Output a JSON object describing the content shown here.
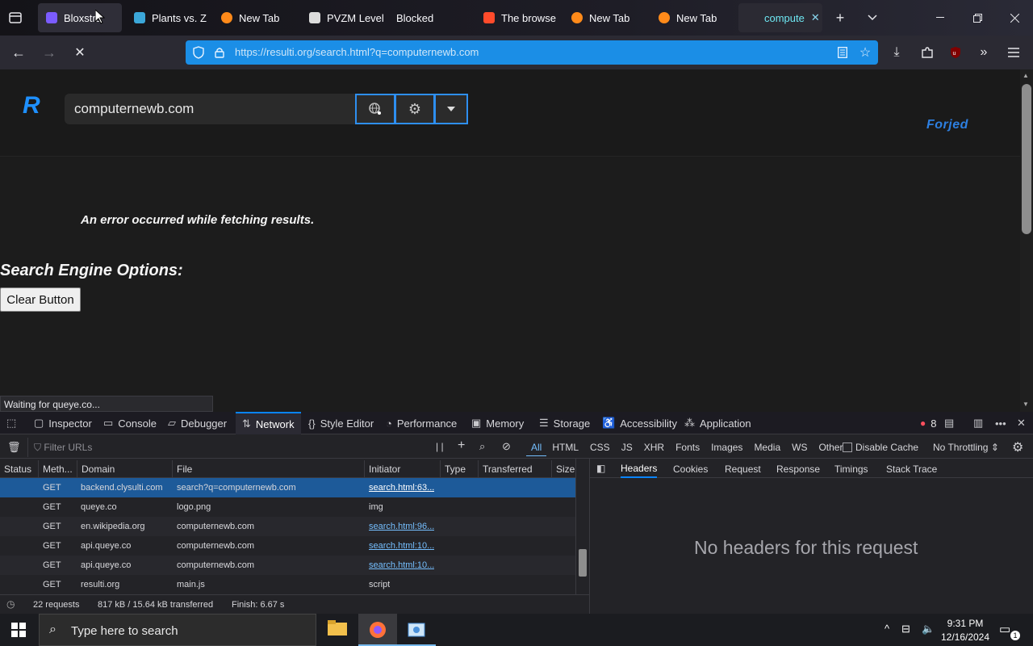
{
  "tabs": [
    {
      "label": "Bloxstra",
      "color": "#7b5cff"
    },
    {
      "label": "Plants vs. Z",
      "color": "#3ba7d9"
    },
    {
      "label": "New Tab",
      "color": "#ff8a1a"
    },
    {
      "label": "PVZM Level",
      "color": "#dcdcdc"
    },
    {
      "label": "Blocked",
      "color": ""
    },
    {
      "label": "The browse",
      "color": "#ff4b2b"
    },
    {
      "label": "New Tab",
      "color": "#ff8a1a"
    },
    {
      "label": "New Tab",
      "color": "#ff8a1a"
    },
    {
      "label": "compute",
      "color": ""
    }
  ],
  "url": {
    "domain": "resulti.org",
    "full": "https://resulti.org/search.html?q=computernewb.com"
  },
  "page": {
    "logo": "R",
    "search_value": "computernewb.com",
    "brand": "Forjed",
    "error": "An error occurred while fetching results.",
    "options_heading": "Search Engine Options:",
    "clear_button": "Clear Button",
    "status": "Waiting for queye.co..."
  },
  "devtools": {
    "tabs": [
      "Inspector",
      "Console",
      "Debugger",
      "Network",
      "Style Editor",
      "Performance",
      "Memory",
      "Storage",
      "Accessibility",
      "Application"
    ],
    "error_count": "8",
    "filter_placeholder": "Filter URLs",
    "type_filters": [
      "All",
      "HTML",
      "CSS",
      "JS",
      "XHR",
      "Fonts",
      "Images",
      "Media",
      "WS",
      "Other"
    ],
    "disable_cache": "Disable Cache",
    "throttling": "No Throttling",
    "columns": [
      "Status",
      "Meth...",
      "Domain",
      "File",
      "Initiator",
      "Type",
      "Transferred",
      "Size"
    ],
    "requests": [
      {
        "method": "GET",
        "domain": "backend.clysulti.com",
        "file": "search?q=computernewb.com",
        "initiator": "search.html:63...",
        "link": true
      },
      {
        "method": "GET",
        "domain": "queye.co",
        "file": "logo.png",
        "initiator": "img",
        "link": false
      },
      {
        "method": "GET",
        "domain": "en.wikipedia.org",
        "file": "computernewb.com",
        "initiator": "search.html:96...",
        "link": true
      },
      {
        "method": "GET",
        "domain": "api.queye.co",
        "file": "computernewb.com",
        "initiator": "search.html:10...",
        "link": true
      },
      {
        "method": "GET",
        "domain": "api.queye.co",
        "file": "computernewb.com",
        "initiator": "search.html:10...",
        "link": true
      },
      {
        "method": "GET",
        "domain": "resulti.org",
        "file": "main.js",
        "initiator": "script",
        "link": false
      }
    ],
    "panel_tabs": [
      "Headers",
      "Cookies",
      "Request",
      "Response",
      "Timings",
      "Stack Trace"
    ],
    "no_headers": "No headers for this request",
    "summary": {
      "requests": "22 requests",
      "size": "817 kB / 15.64 kB transferred",
      "finish": "Finish: 6.67 s"
    }
  },
  "taskbar": {
    "search_placeholder": "Type here to search",
    "time": "9:31 PM",
    "date": "12/16/2024",
    "notif": "1"
  }
}
